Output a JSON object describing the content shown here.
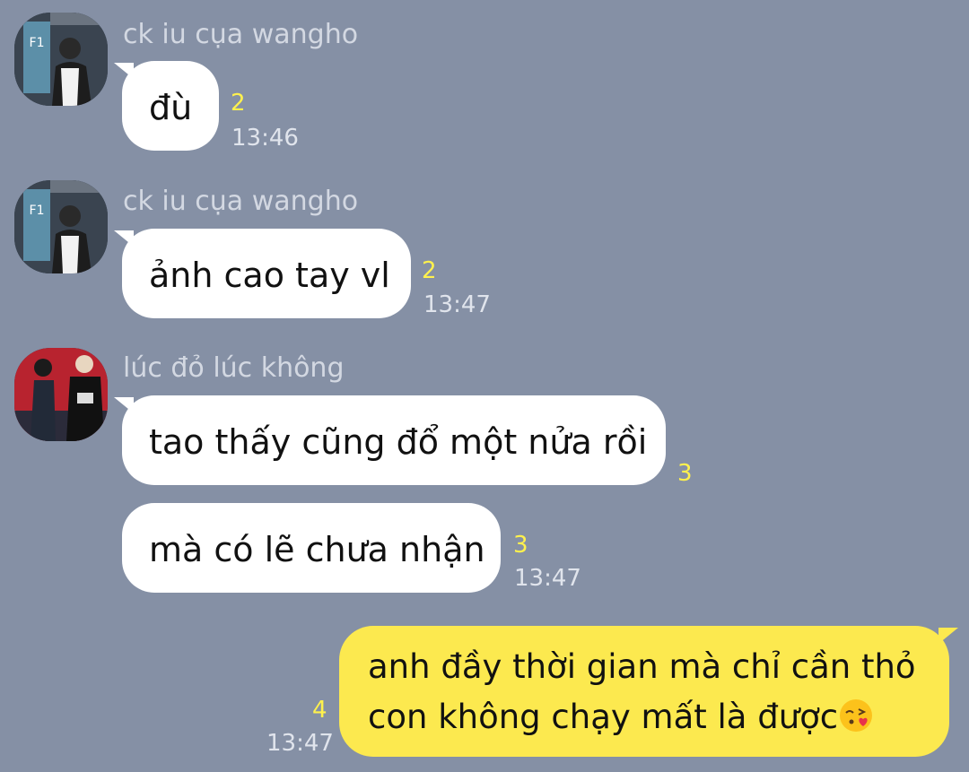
{
  "messages": [
    {
      "sender": "ck iu cụa wangho",
      "text": "đù",
      "unread": "2",
      "time": "13:46"
    },
    {
      "sender": "ck iu cụa wangho",
      "text": "ảnh cao tay vl",
      "unread": "2",
      "time": "13:47"
    },
    {
      "sender": "lúc đỏ lúc không",
      "text": "tao thấy cũng đổ một nửa rồi",
      "unread": "3"
    },
    {
      "text": "mà có lẽ chưa nhận",
      "unread": "3",
      "time": "13:47"
    }
  ],
  "outgoing": {
    "line1": "anh đầy thời gian mà chỉ cần thỏ",
    "line2": "con không chạy mất là được",
    "emoji": "face-blowing-kiss-icon",
    "unread": "4",
    "time": "13:47"
  },
  "colors": {
    "background": "#8590a5",
    "incoming_bubble": "#ffffff",
    "outgoing_bubble": "#fce94f",
    "unread_count": "#fff14d"
  }
}
